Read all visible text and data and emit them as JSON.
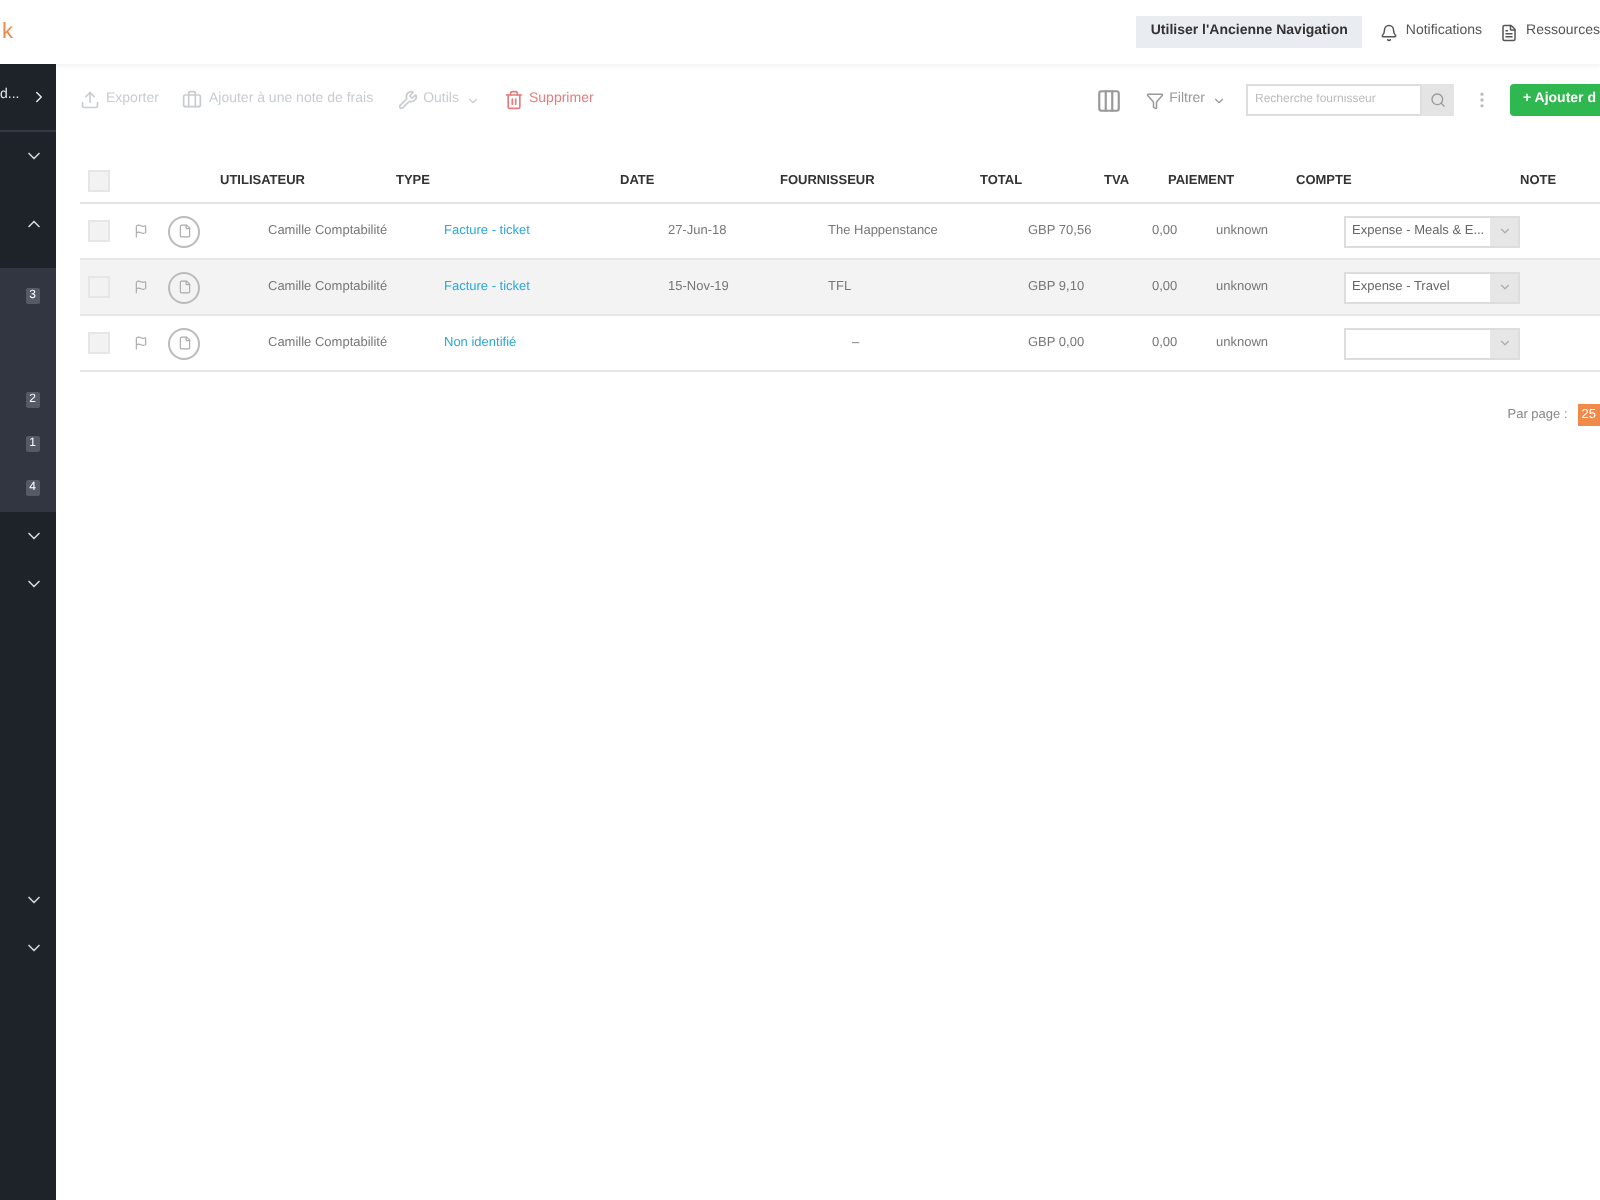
{
  "logo": {
    "text": "k"
  },
  "topbar": {
    "old_nav_button": "Utiliser l'Ancienne Navigation",
    "links": [
      {
        "label": "Notifications",
        "kind": "bell"
      },
      {
        "label": "Ressources",
        "kind": "doc"
      }
    ]
  },
  "sidebar": {
    "header": "d...",
    "groups": [
      {
        "expanded": false
      },
      {
        "expanded": true,
        "badges": [
          "3",
          "2",
          "1",
          "4"
        ]
      },
      {
        "expanded": false
      },
      {
        "expanded": false
      }
    ],
    "lower_groups": [
      {
        "expanded": false
      },
      {
        "expanded": false
      }
    ]
  },
  "toolbar": {
    "actions": [
      {
        "label": "Exporter",
        "kind": "export",
        "disabled": true
      },
      {
        "label": "Ajouter à une note de frais",
        "kind": "report",
        "disabled": true
      },
      {
        "label": "Outils",
        "kind": "tools",
        "disabled": true
      },
      {
        "label": "Supprimer",
        "kind": "delete",
        "disabled": false
      }
    ],
    "filter": "Filtrer",
    "search": {
      "placeholder": "Recherche fournisseur"
    },
    "add_button": "+ Ajouter d"
  },
  "table": {
    "header_checked": false,
    "columns": [
      "UTILISATEUR",
      "TYPE",
      "DATE",
      "FOURNISSEUR",
      "TOTAL",
      "TVA",
      "PAIEMENT",
      "COMPTE",
      "NOTE"
    ],
    "rows": [
      {
        "selected": false,
        "checked": false,
        "user": "Camille Comptabilité",
        "type": "Facture - ticket",
        "date": "27-Jun-18",
        "supplier": "The Happenstance",
        "total": "GBP 70,56",
        "tva": "0,00",
        "payment": "unknown",
        "account": "Expense - Meals & E..."
      },
      {
        "selected": true,
        "checked": false,
        "user": "Camille Comptabilité",
        "type": "Facture - ticket",
        "date": "15-Nov-19",
        "supplier": "TFL",
        "total": "GBP 9,10",
        "tva": "0,00",
        "payment": "unknown",
        "account": "Expense - Travel"
      },
      {
        "selected": false,
        "checked": false,
        "user": "Camille Comptabilité",
        "type": "Non identifié",
        "supplier": "–",
        "total": "GBP 0,00",
        "tva": "0,00",
        "payment": "unknown"
      }
    ]
  },
  "pagination": {
    "label": "Par page :",
    "value": "25"
  }
}
